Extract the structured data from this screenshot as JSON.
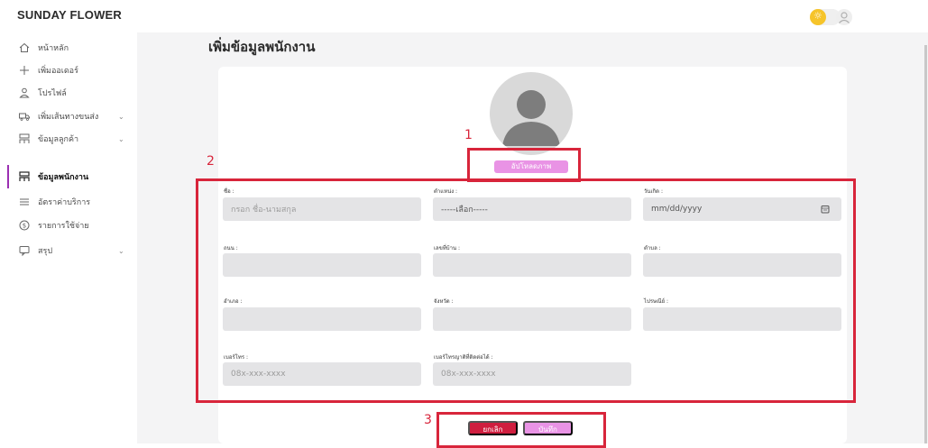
{
  "brand": "SUNDAY FLOWER",
  "sidebar": {
    "items": [
      {
        "label": "หน้าหลัก",
        "icon": "home-icon"
      },
      {
        "label": "เพิ่มออเดอร์",
        "icon": "plus-icon"
      },
      {
        "label": "โปรไฟล์",
        "icon": "user-icon"
      },
      {
        "label": "เพิ่มเส้นทางขนส่ง",
        "icon": "truck-icon"
      },
      {
        "label": "ข้อมูลลูกค้า",
        "icon": "customers-icon"
      },
      {
        "label": "ข้อมูลพนักงาน",
        "icon": "employees-icon"
      },
      {
        "label": "อัตราค่าบริการ",
        "icon": "list-icon"
      },
      {
        "label": "รายการใช้จ่าย",
        "icon": "money-icon"
      },
      {
        "label": "สรุป",
        "icon": "chat-icon"
      }
    ]
  },
  "page": {
    "title": "เพิ่มข้อมูลพนักงาน",
    "upload_label": "อัปโหลดภาพ",
    "cancel_label": "ยกเลิก",
    "save_label": "บันทึก"
  },
  "form": {
    "name_label": "ชื่อ :",
    "name_placeholder": "กรอก ชื่อ-นามสกุล",
    "position_label": "ตำแหน่ง :",
    "position_value": "-----เลือก-----",
    "birthday_label": "วันเกิด :",
    "birthday_value": "mm/dd/yyyy",
    "road_label": "ถนน :",
    "house_no_label": "เลขที่บ้าน :",
    "subdistrict_label": "ตำบล :",
    "district_label": "อำเภอ :",
    "province_label": "จังหวัด :",
    "postcode_label": "ไปรษณีย์ :",
    "phone_label": "เบอร์โทร :",
    "phone_placeholder": "08x-xxx-xxxx",
    "emergency_label": "เบอร์โทรญาติที่ติดต่อได้ :",
    "emergency_placeholder": "08x-xxx-xxxx"
  },
  "annotations": {
    "n1": "1",
    "n2": "2",
    "n3": "3"
  },
  "colors": {
    "accent": "#e993e5",
    "danger": "#cf1e3f",
    "annotation": "#d8253b",
    "active_bar": "#9b2fb2"
  }
}
